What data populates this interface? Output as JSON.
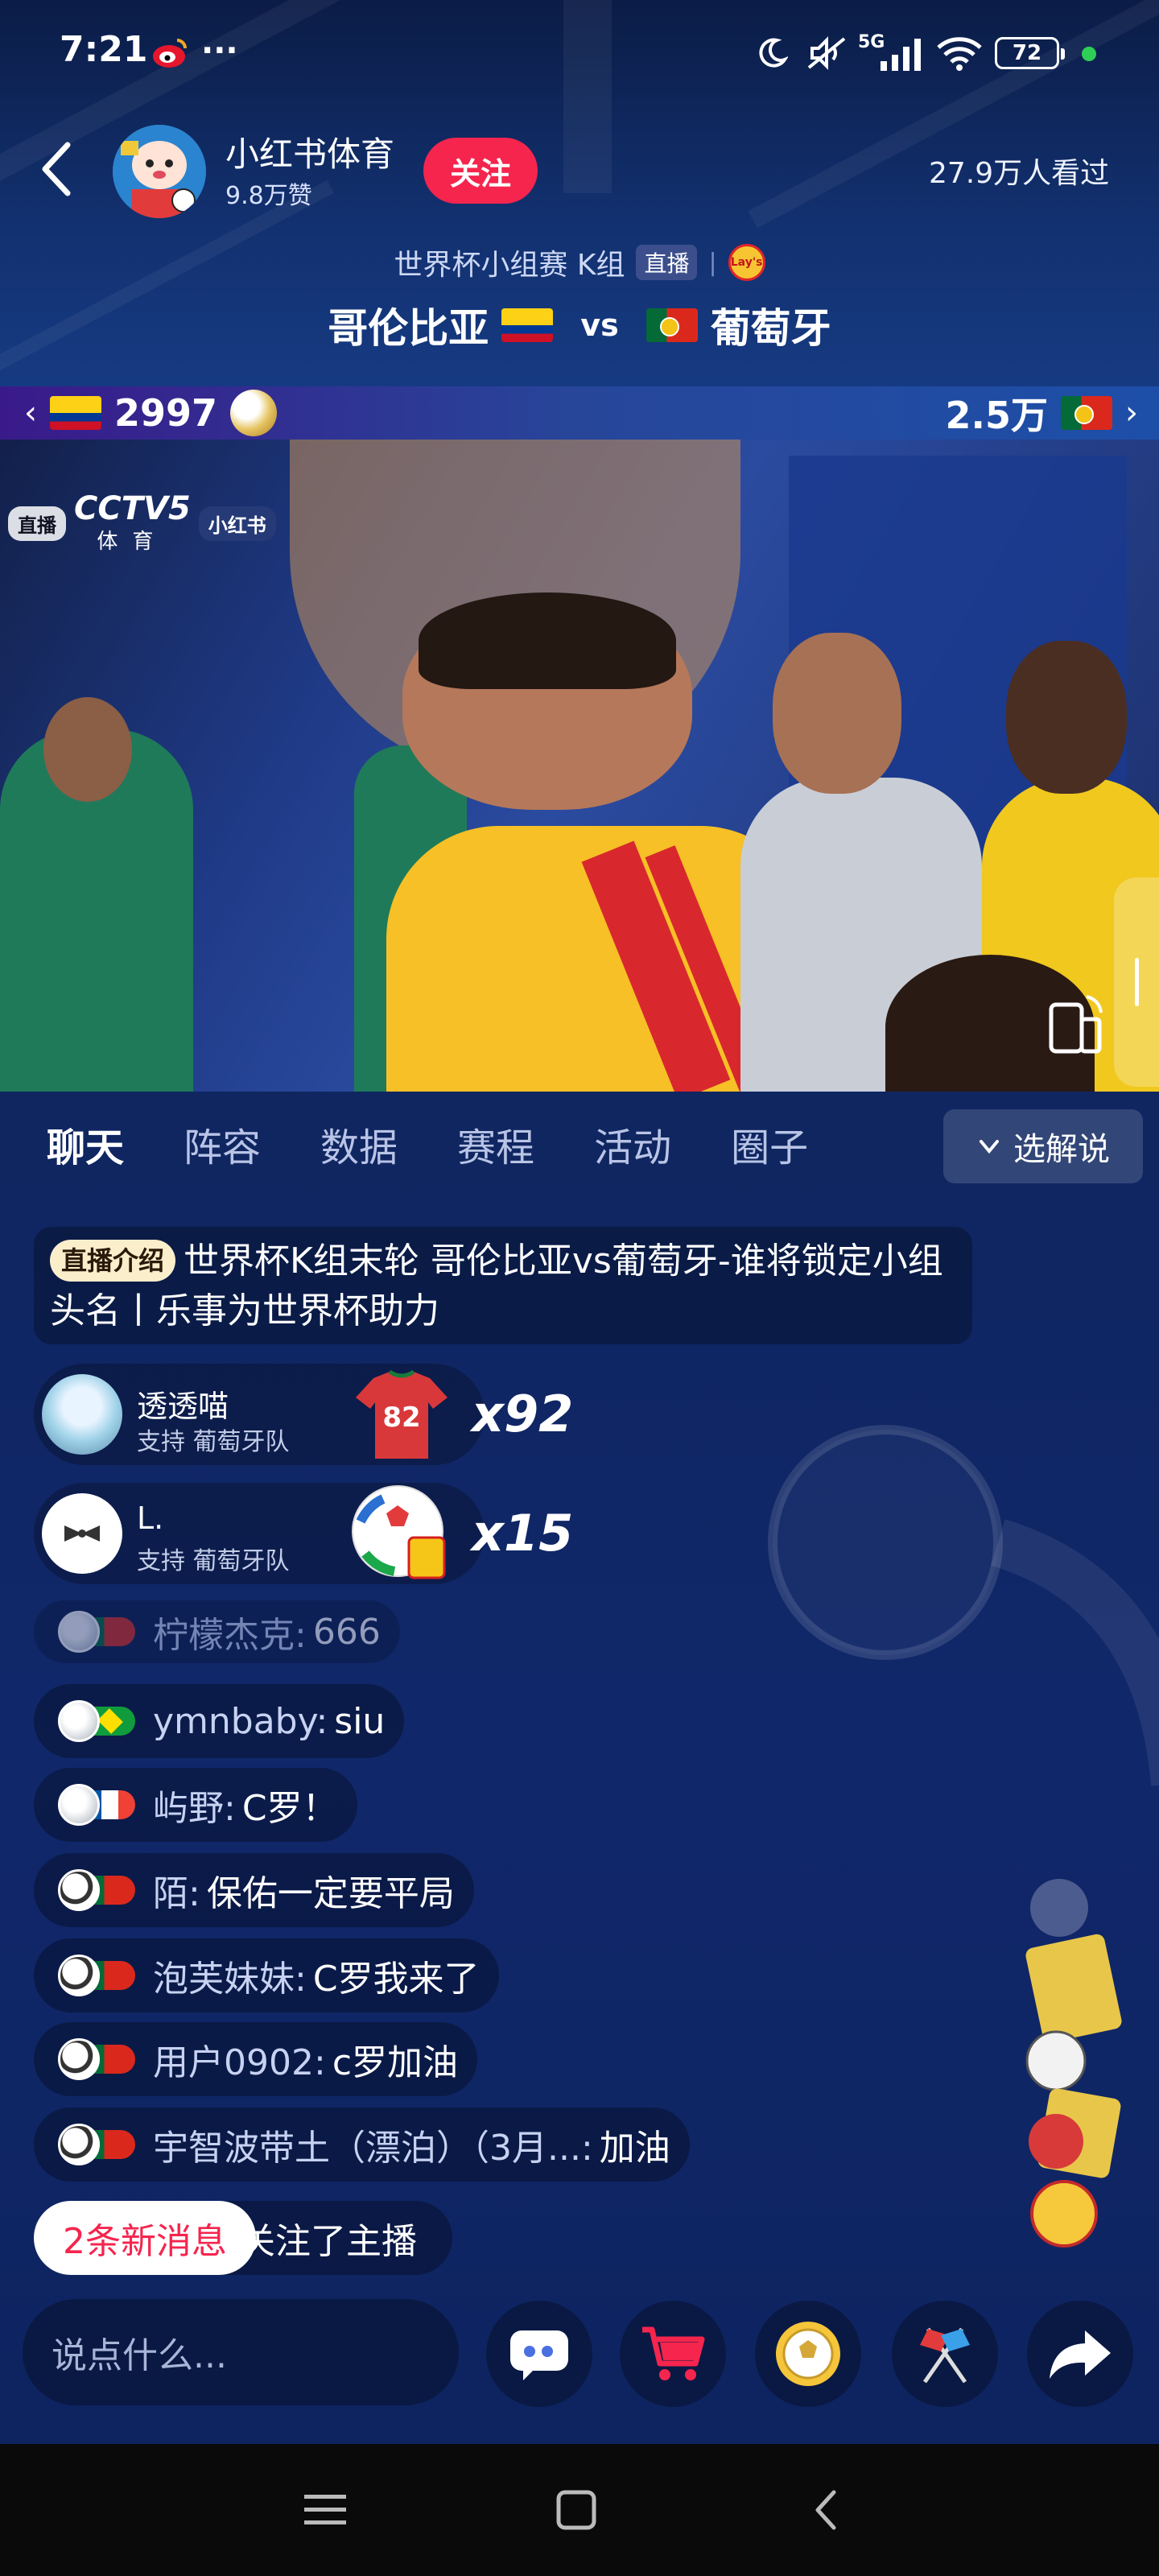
{
  "status_bar": {
    "time": "7:21",
    "more": "···",
    "network": "5G",
    "battery": "72"
  },
  "header": {
    "host_name": "小红书体育",
    "host_likes": "9.8万赞",
    "follow_label": "关注",
    "viewers": "27.9万人看过"
  },
  "match": {
    "subtitle": "世界杯小组赛 K组",
    "live_tag": "直播",
    "sponsor_logo": "Lay's",
    "team_left": "哥伦比亚",
    "vs": "vs",
    "team_right": "葡萄牙"
  },
  "support_bar": {
    "left_count": "2997",
    "right_count": "2.5万"
  },
  "video": {
    "badge_live": "直播",
    "channel": "CCTV5",
    "channel_sub": "体育",
    "badge_brand": "小红书"
  },
  "tabs": [
    {
      "label": "聊天",
      "active": true
    },
    {
      "label": "阵容"
    },
    {
      "label": "数据"
    },
    {
      "label": "赛程"
    },
    {
      "label": "活动"
    },
    {
      "label": "圈子"
    }
  ],
  "commentary_button": "选解说",
  "intro": {
    "tag": "直播介绍",
    "text": "世界杯K组末轮 哥伦比亚vs葡萄牙-谁将锁定小组头名丨乐事为世界杯助力"
  },
  "gifts": [
    {
      "user": "透透喵",
      "support": "支持 葡萄牙队",
      "count": "x92"
    },
    {
      "user": "L.",
      "support": "支持 葡萄牙队",
      "count": "x15"
    }
  ],
  "chat": [
    {
      "name": "柠檬杰克:",
      "msg": "666"
    },
    {
      "name": "ymnbaby:",
      "msg": "siu"
    },
    {
      "name": "屿野:",
      "msg": "C罗！"
    },
    {
      "name": "陌:",
      "msg": "保佑一定要平局"
    },
    {
      "name": "泡芙妹妹:",
      "msg": "C罗我来了"
    },
    {
      "name": "用户0902:",
      "msg": "c罗加油"
    },
    {
      "name": "宇智波带土（漂泊）（3月...:",
      "msg": "加油"
    },
    {
      "name": "",
      "msg": "关注了主播"
    }
  ],
  "new_messages": "2条新消息",
  "input_placeholder": "说点什么...",
  "colors": {
    "accent": "#f5254e",
    "header_bg": "#12306e",
    "chat_bg": "#10276a"
  },
  "icons": [
    "back-icon",
    "danmaku-icon",
    "cart-icon",
    "ball-icon",
    "flags-icon",
    "share-icon",
    "rotate-screen-icon",
    "menu-icon",
    "home-icon",
    "nav-back-icon"
  ]
}
